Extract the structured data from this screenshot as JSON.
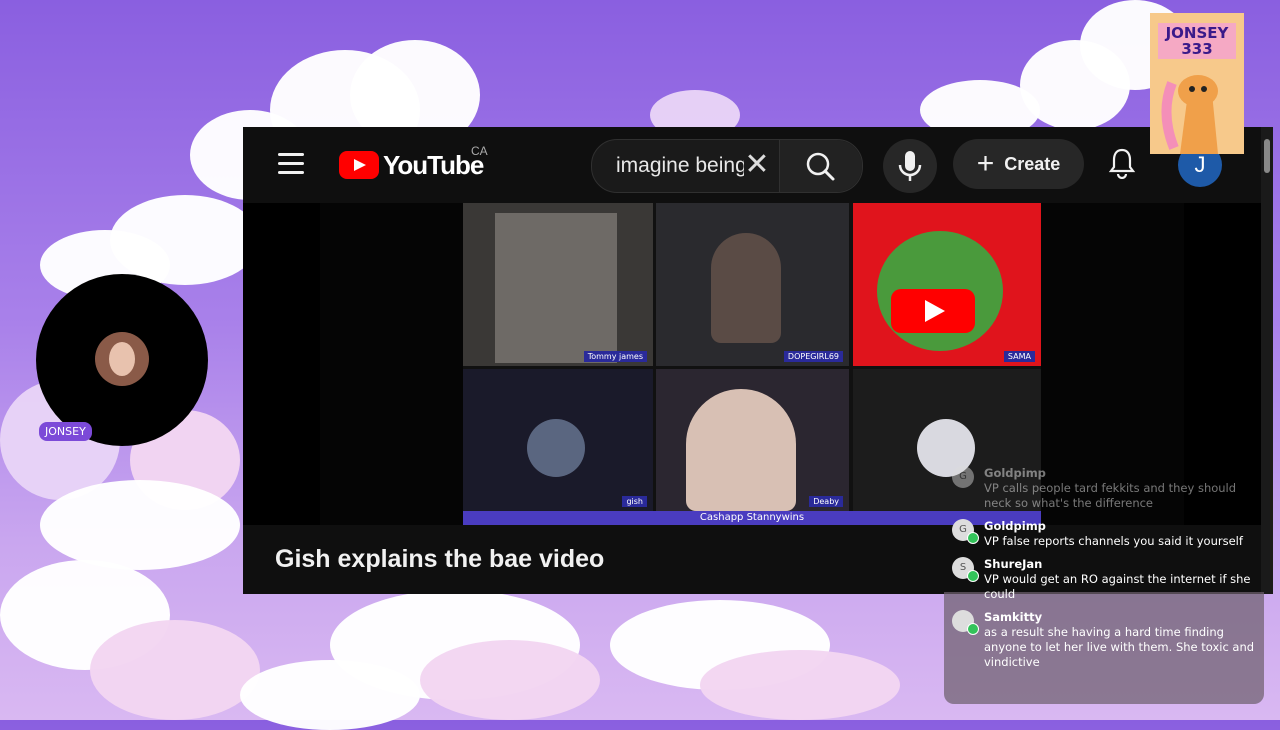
{
  "youtube": {
    "logo_text": "YouTube",
    "country_code": "CA",
    "search_value": "imagine being",
    "clear_symbol": "✕",
    "create_label": "Create",
    "create_plus": "+",
    "account_initial": "J",
    "video_title": "Gish explains the bae video",
    "tiles": {
      "tile1_name": "Tommy james",
      "tile2_name": "DOPEGIRL69",
      "tile3_name": "SAMA",
      "tile5_name": "gish",
      "tile6_name": "Deaby",
      "banner": "Cashapp Stannywins"
    }
  },
  "sticker": {
    "line1": "JONSEY",
    "line2": "333"
  },
  "webcam": {
    "label": "JONSEY"
  },
  "chat": {
    "messages": [
      {
        "user": "Goldpimp",
        "avatar": "G",
        "text": "VP calls people tard fekkits and they should neck so what's the difference"
      },
      {
        "user": "Goldpimp",
        "avatar": "G",
        "text": "VP false reports channels you said it yourself"
      },
      {
        "user": "ShureJan",
        "avatar": "S",
        "text": "VP would get an RO against the internet if she could"
      },
      {
        "user": "Samkitty",
        "avatar": "",
        "text": "as a result she having a hard time finding anyone to let her live with them. She toxic and vindictive"
      }
    ]
  },
  "colors": {
    "background": "#8a5fe0",
    "youtube_red": "#ff0000",
    "youtube_bg": "#0f0f0f",
    "chat_badge": "#33c35a",
    "webcam_label": "#7c4ad8"
  }
}
